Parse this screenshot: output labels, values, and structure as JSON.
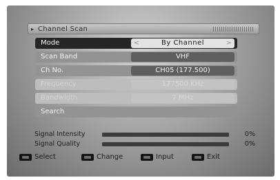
{
  "window": {
    "title": "Channel Scan"
  },
  "menu": {
    "mode": {
      "label": "Mode",
      "value": "By Channel"
    },
    "scan_band": {
      "label": "Scan Band",
      "value": "VHF"
    },
    "ch_no": {
      "label": "Ch No.",
      "value": "CH05 (177.500)"
    },
    "disabled_row_1": {
      "label": "Frequency",
      "value": "177500 KHz"
    },
    "disabled_row_2": {
      "label": "Bandwidth",
      "value": "7 MHz"
    },
    "search": {
      "label": "Search"
    }
  },
  "signal": {
    "intensity": {
      "label": "Signal Intensity",
      "value": "0%",
      "level": 0
    },
    "quality": {
      "label": "Signal Quality",
      "value": "0%",
      "level": 0
    }
  },
  "legend": {
    "select": "Select",
    "change": "Change",
    "input": "Input",
    "exit": "Exit"
  }
}
